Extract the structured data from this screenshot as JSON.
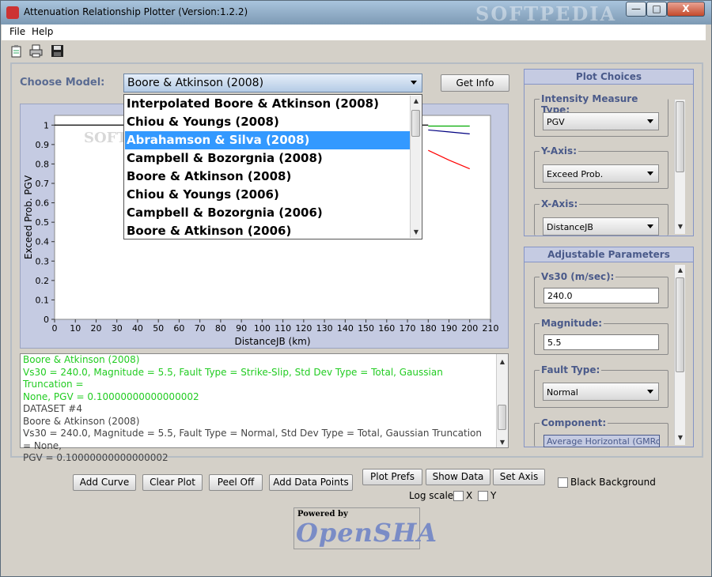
{
  "window": {
    "title": "Attenuation Relationship Plotter (Version:1.2.2)",
    "watermark": "SOFTPEDIA",
    "min": "—",
    "max": "□",
    "close": "X"
  },
  "menu": {
    "items": [
      "File",
      "Help"
    ]
  },
  "toolbar": {
    "icons": [
      "clipboard-icon",
      "printer-icon",
      "save-disk-icon"
    ]
  },
  "model": {
    "label": "Choose Model:",
    "selected": "Boore & Atkinson (2008)",
    "get_info": "Get Info",
    "options": [
      "Interpolated Boore & Atkinson (2008)",
      "Chiou & Youngs (2008)",
      "Abrahamson & Silva (2008)",
      "Campbell & Bozorgnia (2008)",
      "Boore & Atkinson (2008)",
      "Chiou & Youngs (2006)",
      "Campbell & Bozorgnia (2006)",
      "Boore & Atkinson (2006)"
    ],
    "highlighted_index": 2
  },
  "chart_data": {
    "type": "line",
    "watermark": "SOFTPEDIA",
    "xlabel": "DistanceJB (km)",
    "ylabel": "Exceed Prob. PGV",
    "xlim": [
      0,
      210
    ],
    "ylim": [
      0,
      1.05
    ],
    "x_ticks": [
      0,
      10,
      20,
      30,
      40,
      50,
      60,
      70,
      80,
      90,
      100,
      110,
      120,
      130,
      140,
      150,
      160,
      170,
      180,
      190,
      200,
      210
    ],
    "y_ticks": [
      0,
      0.1,
      0.2,
      0.3,
      0.4,
      0.5,
      0.6,
      0.7,
      0.8,
      0.9,
      1
    ],
    "y_tick_labels": [
      "0",
      "0.1",
      "0.2",
      "0.3",
      "0.4",
      "0.5",
      "0.6",
      "0.7",
      "0.8",
      "0.9",
      "1"
    ],
    "series": [
      {
        "color": "#000000",
        "x": [
          0,
          180
        ],
        "y": [
          1.0,
          1.0
        ]
      },
      {
        "color": "#00aa00",
        "x": [
          180,
          200
        ],
        "y": [
          0.995,
          0.995
        ]
      },
      {
        "color": "#000080",
        "x": [
          180,
          190,
          200
        ],
        "y": [
          0.975,
          0.965,
          0.955
        ]
      },
      {
        "color": "#ff0000",
        "x": [
          180,
          190,
          200
        ],
        "y": [
          0.87,
          0.82,
          0.775
        ]
      }
    ]
  },
  "info": {
    "green_lines": [
      "Boore & Atkinson (2008)",
      "Vs30 = 240.0, Magnitude = 5.5, Fault Type = Strike-Slip, Std Dev Type = Total, Gaussian Truncation =",
      "None, PGV = 0.10000000000000002"
    ],
    "dark_lines": [
      "DATASET #4",
      "Boore & Atkinson (2008)",
      "Vs30 = 240.0, Magnitude = 5.5, Fault Type = Normal, Std Dev Type = Total, Gaussian Truncation = None,",
      "PGV = 0.10000000000000002"
    ]
  },
  "plot_choices": {
    "title": "Plot Choices",
    "intensity_label": "Intensity Measure Type:",
    "intensity_value": "PGV",
    "yaxis_label": "Y-Axis:",
    "yaxis_value": "Exceed Prob.",
    "xaxis_label": "X-Axis:",
    "xaxis_value": "DistanceJB"
  },
  "adjustable": {
    "title": "Adjustable Parameters",
    "vs30_label": "Vs30 (m/sec):",
    "vs30_value": "240.0",
    "mag_label": "Magnitude:",
    "mag_value": "5.5",
    "fault_label": "Fault Type:",
    "fault_value": "Normal",
    "component_label": "Component:",
    "component_value": "Average Horizontal (GMRot"
  },
  "buttons": {
    "add_curve": "Add Curve",
    "clear_plot": "Clear Plot",
    "peel_off": "Peel Off",
    "add_data_points": "Add Data Points",
    "plot_prefs": "Plot Prefs",
    "show_data": "Show Data",
    "set_axis": "Set Axis",
    "black_background": "Black Background",
    "log_scale": "Log scale:",
    "log_x": "X",
    "log_y": "Y"
  },
  "logo": {
    "powered_by": "Powered by",
    "name": "OpenSHA"
  }
}
